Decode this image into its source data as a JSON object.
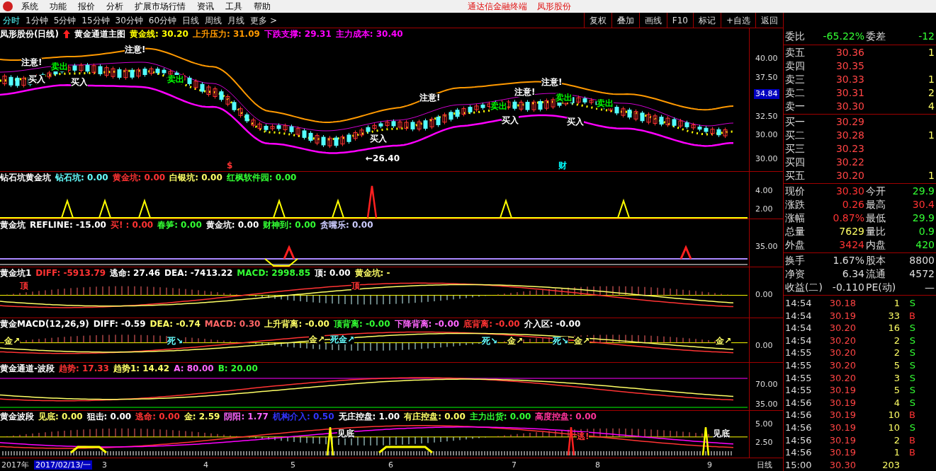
{
  "menu_bar": {
    "items": [
      "系统",
      "功能",
      "报价",
      "分析",
      "扩展市场行情",
      "资讯",
      "工具",
      "帮助"
    ],
    "title": "通达信金融终端",
    "stock": "凤形股份"
  },
  "period_tabs": [
    {
      "label": "分时",
      "selected": true
    },
    {
      "label": "1分钟",
      "selected": false
    },
    {
      "label": "5分钟",
      "selected": false
    },
    {
      "label": "15分钟",
      "selected": false
    },
    {
      "label": "30分钟",
      "selected": false
    },
    {
      "label": "60分钟",
      "selected": false
    },
    {
      "label": "日线",
      "selected": false
    },
    {
      "label": "周线",
      "selected": false
    },
    {
      "label": "月线",
      "selected": false
    },
    {
      "label": "更多 >",
      "selected": false
    }
  ],
  "toolbar_buttons": [
    "复权",
    "叠加",
    "画线",
    "F10",
    "标记",
    "+自选",
    "返回"
  ],
  "panels": [
    {
      "kind": "main",
      "legend": [
        {
          "text": "凤形股份(日线)",
          "color": "#ffffff"
        },
        {
          "text": "黄金通道主图",
          "color": "#ffffff"
        },
        {
          "text": "黄金线: 30.20",
          "color": "#ffff00"
        },
        {
          "text": "上升压力: 31.09",
          "color": "#ff9900"
        },
        {
          "text": "下跌支撑: 29.31",
          "color": "#ff00ff"
        },
        {
          "text": "主力成本: 30.40",
          "color": "#ff00ff"
        }
      ],
      "axis": [
        {
          "label": "40.00",
          "highlight": false
        },
        {
          "label": "37.50",
          "highlight": false
        },
        {
          "label": "34.84",
          "highlight": true
        },
        {
          "label": "32.50",
          "highlight": false
        },
        {
          "label": "30.00",
          "highlight": false
        },
        {
          "label": "30.00",
          "highlight": false
        }
      ],
      "annotations": [
        {
          "text": "注意!",
          "color": "#ffffff"
        },
        {
          "text": "买入",
          "color": "#ffffff"
        },
        {
          "text": "卖出",
          "color": "#00ff00"
        },
        {
          "text": "买入",
          "color": "#ffffff"
        },
        {
          "text": "注意!",
          "color": "#ffffff"
        },
        {
          "text": "卖出",
          "color": "#00ff00"
        },
        {
          "text": "$",
          "color": "#ff3333"
        },
        {
          "text": "←26.40",
          "color": "#ffffff"
        },
        {
          "text": "买入",
          "color": "#ffffff"
        },
        {
          "text": "注意!",
          "color": "#ffffff"
        },
        {
          "text": "卖出",
          "color": "#00ff00"
        },
        {
          "text": "买入",
          "color": "#ffffff"
        },
        {
          "text": "注意!",
          "color": "#ffffff"
        },
        {
          "text": "注意!",
          "color": "#ffffff"
        },
        {
          "text": "卖出",
          "color": "#00ff00"
        },
        {
          "text": "财",
          "color": "#00ffff"
        },
        {
          "text": "买入",
          "color": "#ffffff"
        },
        {
          "text": "卖出",
          "color": "#00ff00"
        }
      ]
    },
    {
      "kind": "peaks",
      "legend": [
        {
          "text": "钻石坑黄金坑",
          "color": "#ffffff"
        },
        {
          "text": "钻石坑: 0.00",
          "color": "#66ffff"
        },
        {
          "text": "黄金坑: 0.00",
          "color": "#ff3333"
        },
        {
          "text": "白银坑: 0.00",
          "color": "#ffff66"
        },
        {
          "text": "红枫软件园: 0.00",
          "color": "#33ff33"
        }
      ],
      "axis": [
        {
          "label": "4.00",
          "highlight": false
        },
        {
          "label": "2.00",
          "highlight": false
        }
      ]
    },
    {
      "kind": "refline",
      "legend": [
        {
          "text": "黄金坑",
          "color": "#ffffff"
        },
        {
          "text": "REFLINE: -15.00",
          "color": "#ffffff"
        },
        {
          "text": "买! : 0.00",
          "color": "#ff3333"
        },
        {
          "text": "春笋: 0.00",
          "color": "#33ff33"
        },
        {
          "text": "黄金坑: 0.00",
          "color": "#ffffff"
        },
        {
          "text": "财神到: 0.00",
          "color": "#33ff33"
        },
        {
          "text": "贪嘴乐: 0.00",
          "color": "#ccccff"
        }
      ],
      "axis": [
        {
          "label": "35.00",
          "highlight": false
        }
      ]
    },
    {
      "kind": "macd",
      "legend": [
        {
          "text": "黄金坑1",
          "color": "#ffffff"
        },
        {
          "text": "DIFF: -5913.79",
          "color": "#ff3333"
        },
        {
          "text": "逃命: 27.46",
          "color": "#ffffff"
        },
        {
          "text": "DEA: -7413.22",
          "color": "#ffffff"
        },
        {
          "text": "MACD: 2998.85",
          "color": "#33ff33"
        },
        {
          "text": "顶: 0.00",
          "color": "#ffffff"
        },
        {
          "text": "黄金坑: -",
          "color": "#ffff66"
        }
      ],
      "axis": [
        {
          "label": "0.00",
          "highlight": false
        }
      ],
      "annotations": [
        {
          "text": "顶",
          "color": "#ff3333"
        },
        {
          "text": "顶",
          "color": "#ff3333"
        }
      ]
    },
    {
      "kind": "macd2",
      "legend": [
        {
          "text": "黄金MACD(12,26,9)",
          "color": "#ffffff"
        },
        {
          "text": "DIFF: -0.59",
          "color": "#ffffff"
        },
        {
          "text": "DEA: -0.74",
          "color": "#ffff66"
        },
        {
          "text": "MACD: 0.30",
          "color": "#ff6666"
        },
        {
          "text": "上升背离: -0.00",
          "color": "#ffff66"
        },
        {
          "text": "顶背离: -0.00",
          "color": "#33ff33"
        },
        {
          "text": "下降背离: -0.00",
          "color": "#ff66ff"
        },
        {
          "text": "底背离: -0.00",
          "color": "#ff3333"
        },
        {
          "text": "介入区: -0.00",
          "color": "#ffffff"
        }
      ],
      "axis": [
        {
          "label": "0.00",
          "highlight": false
        }
      ],
      "annotations": [
        {
          "text": "金↗",
          "color": "#ffff66"
        },
        {
          "text": "死↘",
          "color": "#66ffff"
        },
        {
          "text": "金↗",
          "color": "#ffff66"
        },
        {
          "text": "死金↗",
          "color": "#66ffff"
        },
        {
          "text": "死↘",
          "color": "#66ffff"
        },
        {
          "text": "金↗",
          "color": "#ffff66"
        },
        {
          "text": "死↘",
          "color": "#66ffff"
        },
        {
          "text": "金↗",
          "color": "#ffff66"
        },
        {
          "text": "金↗",
          "color": "#ffff66"
        }
      ]
    },
    {
      "kind": "channel",
      "legend": [
        {
          "text": "黄金通道-波段",
          "color": "#ffffff"
        },
        {
          "text": "趋势: 17.33",
          "color": "#ff3333"
        },
        {
          "text": "趋势1: 14.42",
          "color": "#ffff66"
        },
        {
          "text": "A: 80.00",
          "color": "#ff66ff"
        },
        {
          "text": "B: 20.00",
          "color": "#33ff33"
        }
      ],
      "axis": [
        {
          "label": "70.00",
          "highlight": false
        },
        {
          "label": "35.00",
          "highlight": false
        }
      ]
    },
    {
      "kind": "wave",
      "legend": [
        {
          "text": "黄金波段",
          "color": "#ffffff"
        },
        {
          "text": "见底: 0.00",
          "color": "#ffff66"
        },
        {
          "text": "狙击: 0.00",
          "color": "#ffffff"
        },
        {
          "text": "逃命: 0.00",
          "color": "#ff3333"
        },
        {
          "text": "金: 2.59",
          "color": "#ffff66"
        },
        {
          "text": "阴阳: 1.77",
          "color": "#ff66ff"
        },
        {
          "text": "机构介入: 0.50",
          "color": "#3333ff"
        },
        {
          "text": "无庄控盘: 1.00",
          "color": "#ffffff"
        },
        {
          "text": "有庄控盘: 0.00",
          "color": "#ffff66"
        },
        {
          "text": "主力出货: 0.00",
          "color": "#33ff33"
        },
        {
          "text": "高度控盘: 0.00",
          "color": "#ff3399"
        }
      ],
      "axis": [
        {
          "label": "5.00",
          "highlight": false
        },
        {
          "label": "2.50",
          "highlight": false
        }
      ],
      "annotations": [
        {
          "text": "见底",
          "color": "#ffffff"
        },
        {
          "text": "逃!",
          "color": "#ff3333"
        },
        {
          "text": "见底",
          "color": "#ffffff"
        }
      ]
    }
  ],
  "time_axis": [
    {
      "label": "2017年",
      "highlight": false
    },
    {
      "label": "2017/02/13/一",
      "highlight": true
    },
    {
      "label": "3",
      "highlight": false
    },
    {
      "label": "4",
      "highlight": false
    },
    {
      "label": "5",
      "highlight": false
    },
    {
      "label": "6",
      "highlight": false
    },
    {
      "label": "7",
      "highlight": false
    },
    {
      "label": "8",
      "highlight": false
    },
    {
      "label": "9",
      "highlight": false
    }
  ],
  "period_label": "日线",
  "quote": {
    "ratio": {
      "label": "委比",
      "value": "-65.22%",
      "label2": "委差",
      "value2": "-12"
    },
    "asks": [
      {
        "label": "卖五",
        "price": "30.36",
        "volume": "1"
      },
      {
        "label": "卖四",
        "price": "30.35"
      },
      {
        "label": "卖三",
        "price": "30.33",
        "volume": "1"
      },
      {
        "label": "卖二",
        "price": "30.31",
        "volume": "2"
      },
      {
        "label": "卖一",
        "price": "30.30",
        "volume": "4"
      }
    ],
    "bids": [
      {
        "label": "买一",
        "price": "30.29"
      },
      {
        "label": "买二",
        "price": "30.28",
        "volume": "1"
      },
      {
        "label": "买三",
        "price": "30.23"
      },
      {
        "label": "买四",
        "price": "30.22"
      },
      {
        "label": "买五",
        "price": "30.20",
        "volume": "1"
      }
    ],
    "stats": [
      {
        "label": "现价",
        "value": "30.30",
        "color": "#ff3333"
      },
      {
        "label": "今开",
        "value": "29.9",
        "color": "#33ff33"
      },
      {
        "label": "涨跌",
        "value": "0.26",
        "color": "#ff3333"
      },
      {
        "label": "最高",
        "value": "30.4",
        "color": "#ff3333"
      },
      {
        "label": "涨幅",
        "value": "0.87%",
        "color": "#ff3333"
      },
      {
        "label": "最低",
        "value": "29.9",
        "color": "#33ff33"
      },
      {
        "label": "总量",
        "value": "7629",
        "color": "#ffff66"
      },
      {
        "label": "量比",
        "value": "0.9",
        "color": "#33ff33"
      },
      {
        "label": "外盘",
        "value": "3424",
        "color": "#ff3333"
      },
      {
        "label": "内盘",
        "value": "420",
        "color": "#33ff33"
      }
    ],
    "info": [
      {
        "label": "换手",
        "value": "1.67%",
        "label2": "股本",
        "value2": "8800"
      },
      {
        "label": "净资",
        "value": "6.34",
        "label2": "流通",
        "value2": "4572"
      },
      {
        "label": "收益(二)",
        "value": "-0.110",
        "label2": "PE(动)",
        "value2": "—"
      }
    ],
    "ticks": [
      {
        "time": "14:54",
        "price": "30.18",
        "volume": "1",
        "side": "S",
        "kind": "sell"
      },
      {
        "time": "14:54",
        "price": "30.19",
        "volume": "33",
        "side": "B",
        "kind": "buy"
      },
      {
        "time": "14:54",
        "price": "30.20",
        "volume": "16",
        "side": "S",
        "kind": "sell"
      },
      {
        "time": "14:54",
        "price": "30.20",
        "volume": "2",
        "side": "S",
        "kind": "sell"
      },
      {
        "time": "14:55",
        "price": "30.20",
        "volume": "2",
        "side": "S",
        "kind": "sell"
      },
      {
        "time": "14:55",
        "price": "30.20",
        "volume": "5",
        "side": "S",
        "kind": "sell"
      },
      {
        "time": "14:55",
        "price": "30.20",
        "volume": "3",
        "side": "S",
        "kind": "sell"
      },
      {
        "time": "14:55",
        "price": "30.19",
        "volume": "5",
        "side": "S",
        "kind": "sell"
      },
      {
        "time": "14:56",
        "price": "30.19",
        "volume": "4",
        "side": "S",
        "kind": "sell"
      },
      {
        "time": "14:56",
        "price": "30.19",
        "volume": "10",
        "side": "B",
        "kind": "buy"
      },
      {
        "time": "14:56",
        "price": "30.19",
        "volume": "10",
        "side": "S",
        "kind": "sell"
      },
      {
        "time": "14:56",
        "price": "30.19",
        "volume": "2",
        "side": "B",
        "kind": "buy"
      },
      {
        "time": "14:56",
        "price": "30.19",
        "volume": "1",
        "side": "B",
        "kind": "buy"
      },
      {
        "time": "15:00",
        "price": "30.30",
        "volume": "203"
      }
    ]
  }
}
